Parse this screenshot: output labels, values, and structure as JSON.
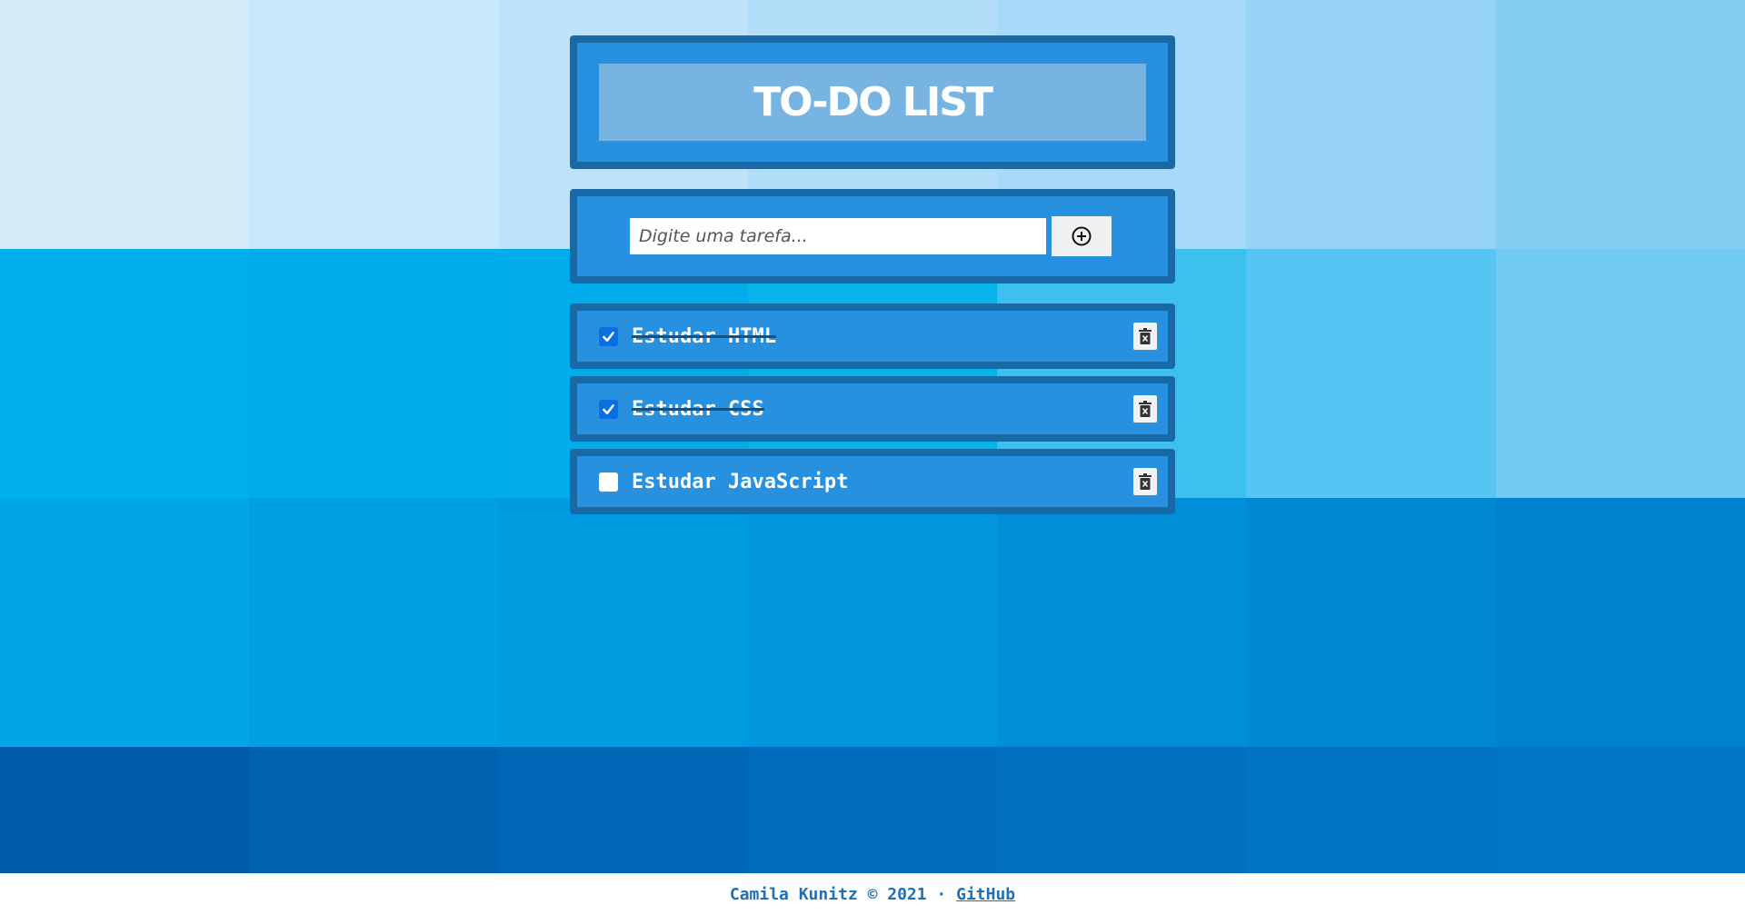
{
  "colors": {
    "background_tiles": [
      [
        "#d6ecfb",
        "#c8e7fa",
        "#bde2f9",
        "#b1ddf9",
        "#a7d9f8",
        "#97d2f7",
        "#86cdf4"
      ],
      [
        "#00afee",
        "#00adec",
        "#00ace9",
        "#07b4ea",
        "#3dc0f0",
        "#56c5f3",
        "#72cbf3"
      ],
      [
        "#00a6e8",
        "#009fe4",
        "#009ce1",
        "#0095dc",
        "#008ed8",
        "#0088d3",
        "#0083cf"
      ],
      [
        "#005caa",
        "#0062b1",
        "#0067b7",
        "#006cbb",
        "#0070bf",
        "#0073c2",
        "#0076c5"
      ]
    ],
    "panel": "#2891df",
    "panel_border": "#1869a6",
    "title_box": "#78b4e2",
    "checkbox_checked": "#0b6fe0",
    "footer_text": "#1d6fb6"
  },
  "header": {
    "title": "TO-DO LIST"
  },
  "new_task": {
    "placeholder": "Digite uma tarefa...",
    "value": "",
    "add_icon": "plus-circle-icon"
  },
  "tasks": [
    {
      "label": "Estudar HTML",
      "done": true,
      "delete_icon": "trash-icon"
    },
    {
      "label": "Estudar CSS",
      "done": true,
      "delete_icon": "trash-icon"
    },
    {
      "label": "Estudar JavaScript",
      "done": false,
      "delete_icon": "trash-icon"
    }
  ],
  "footer": {
    "text": "Camila Kunitz © 2021 · ",
    "link_label": "GitHub"
  }
}
